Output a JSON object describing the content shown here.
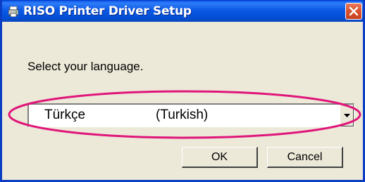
{
  "window": {
    "title": "RISO Printer Driver Setup",
    "icon": "printer-icon",
    "close_icon": "close-icon"
  },
  "prompt": "Select your language.",
  "language_select": {
    "selected_language": "Türkçe",
    "selected_native": "(Turkish)",
    "dropdown_icon": "chevron-down-icon"
  },
  "buttons": {
    "ok": "OK",
    "cancel": "Cancel"
  },
  "colors": {
    "titlebar": "#0450d8",
    "dialog_bg": "#ece9d8",
    "highlight_ellipse": "#e0157a",
    "close_button": "#d8512e"
  }
}
